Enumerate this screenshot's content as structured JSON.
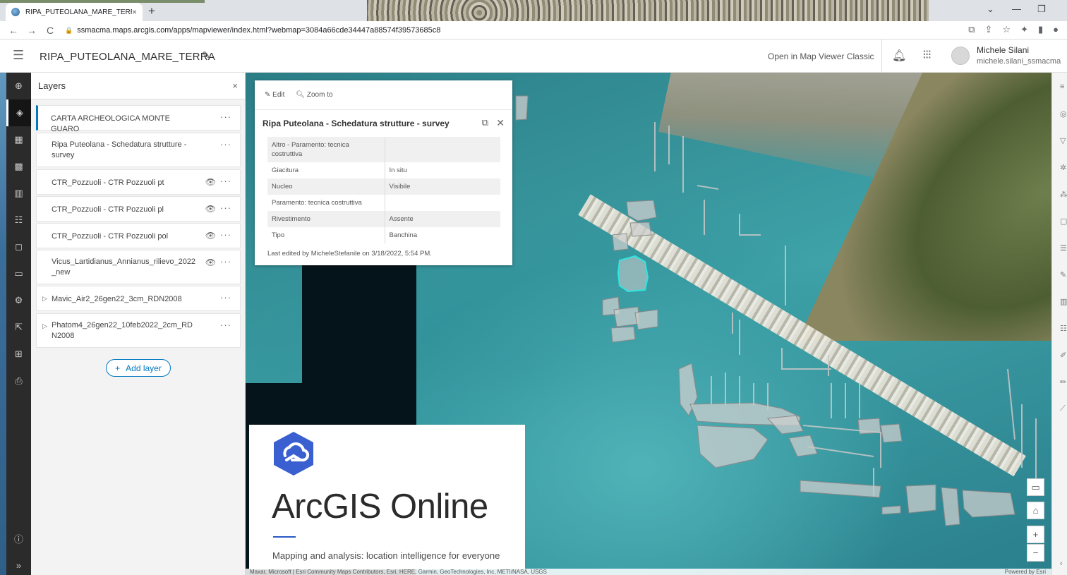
{
  "browser": {
    "tab_title": "RIPA_PUTEOLANA_MARE_TERRA",
    "tab_close": "×",
    "new_tab": "+",
    "url": "ssmacma.maps.arcgis.com/apps/mapviewer/index.html?webmap=3084a66cde34447a88574f39573685c8",
    "back": "←",
    "forward": "→",
    "reload": "C",
    "win_min": "—",
    "win_restore": "❐",
    "win_down": "⌄"
  },
  "header": {
    "map_title": "RIPA_PUTEOLANA_MARE_TERRA",
    "open_classic": "Open in Map Viewer Classic",
    "user_name": "Michele Silani",
    "user_id": "michele.silani_ssmacma"
  },
  "layers_panel": {
    "title": "Layers",
    "close": "×",
    "add_layer": "Add layer",
    "items": [
      {
        "name": "CARTA ARCHEOLOGICA MONTE GUARO"
      },
      {
        "name": "Ripa Puteolana - Schedatura strutture - survey"
      },
      {
        "name": "CTR_Pozzuoli - CTR Pozzuoli pt"
      },
      {
        "name": "CTR_Pozzuoli - CTR Pozzuoli pl"
      },
      {
        "name": "CTR_Pozzuoli - CTR Pozzuoli pol"
      },
      {
        "name": "Vicus_Lartidianus_Annianus_rilievo_2022 _new"
      },
      {
        "name": "Mavic_Air2_26gen22_3cm_RDN2008"
      },
      {
        "name": "Phatom4_26gen22_10feb2022_2cm_RD N2008"
      }
    ]
  },
  "popup": {
    "edit": "Edit",
    "zoom_to": "Zoom to",
    "title": "Ripa Puteolana - Schedatura strutture - survey",
    "rows": [
      {
        "k": "Altro - Paramento: tecnica costruttiva",
        "v": ""
      },
      {
        "k": "Giacitura",
        "v": "In situ"
      },
      {
        "k": "Nucleo",
        "v": "Visibile"
      },
      {
        "k": "Paramento: tecnica costruttiva",
        "v": ""
      },
      {
        "k": "Rivestimento",
        "v": "Assente"
      },
      {
        "k": "Tipo",
        "v": "Banchina"
      }
    ],
    "last_edited": "Last edited by MicheleStefanile on 3/18/2022, 5:54 PM."
  },
  "splash": {
    "product": "ArcGIS Online",
    "tagline": "Mapping and analysis: location intelligence for everyone"
  },
  "attribution": {
    "sources": "Maxar, Microsoft | Esri Community Maps Contributors, Esri, HERE, Garmin, GeoTechnologies, Inc, METI/NASA, USGS",
    "powered": "Powered by Esri"
  },
  "colors": {
    "accent": "#0079c1",
    "selection": "#2ee6e0",
    "logo": "#3a5fd0"
  }
}
